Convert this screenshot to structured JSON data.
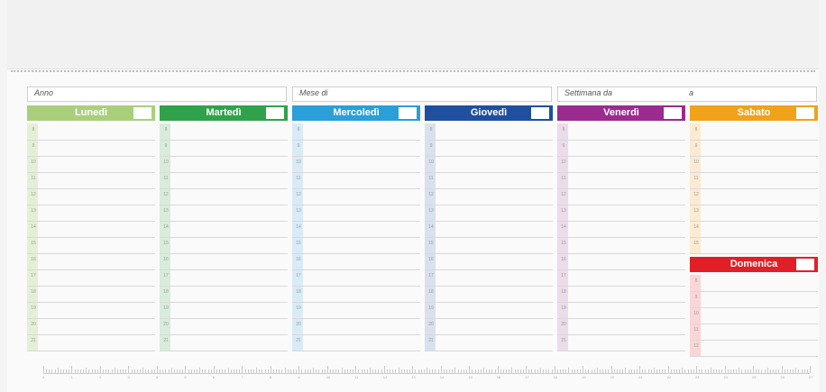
{
  "header": {
    "year_label": "Anno",
    "month_label": "Mese di",
    "week_label": "Settimana da",
    "week_to_label": "a"
  },
  "days": [
    {
      "name": "Lunedì",
      "color": "#a9cf7c",
      "strip": "#e4f0d6",
      "hours": [
        "8",
        "9",
        "10",
        "11",
        "12",
        "13",
        "14",
        "15",
        "16",
        "17",
        "18",
        "19",
        "20",
        "21"
      ]
    },
    {
      "name": "Martedì",
      "color": "#2fa24b",
      "strip": "#d8ecdc",
      "hours": [
        "8",
        "9",
        "10",
        "11",
        "12",
        "13",
        "14",
        "15",
        "16",
        "17",
        "18",
        "19",
        "20",
        "21"
      ]
    },
    {
      "name": "Mercoledì",
      "color": "#2a9fd8",
      "strip": "#d8ebf7",
      "hours": [
        "8",
        "9",
        "10",
        "11",
        "12",
        "13",
        "14",
        "15",
        "16",
        "17",
        "18",
        "19",
        "20",
        "21"
      ]
    },
    {
      "name": "Giovedì",
      "color": "#1f4f9e",
      "strip": "#d9e1ef",
      "hours": [
        "8",
        "9",
        "10",
        "11",
        "12",
        "13",
        "14",
        "15",
        "16",
        "17",
        "18",
        "19",
        "20",
        "21"
      ]
    },
    {
      "name": "Venerdì",
      "color": "#9b2b8f",
      "strip": "#ecdcea",
      "hours": [
        "8",
        "9",
        "10",
        "11",
        "12",
        "13",
        "14",
        "15",
        "16",
        "17",
        "18",
        "19",
        "20",
        "21"
      ]
    },
    {
      "name": "Sabato",
      "color": "#f0a21b",
      "strip": "#fbebd2",
      "hours": [
        "8",
        "9",
        "10",
        "11",
        "12",
        "13",
        "14",
        "15"
      ]
    },
    {
      "name": "Domenica",
      "color": "#e21f26",
      "strip": "#fad6d6",
      "hours": [
        "8",
        "9",
        "10",
        "11",
        "12"
      ]
    }
  ],
  "ruler": {
    "numbers": [
      "0",
      "1",
      "2",
      "3",
      "4",
      "5",
      "6",
      "7",
      "8",
      "9",
      "10",
      "11",
      "12",
      "13",
      "14",
      "15",
      "16",
      "17",
      "18",
      "19",
      "20",
      "21",
      "22",
      "23",
      "24",
      "25",
      "26",
      "27"
    ]
  }
}
